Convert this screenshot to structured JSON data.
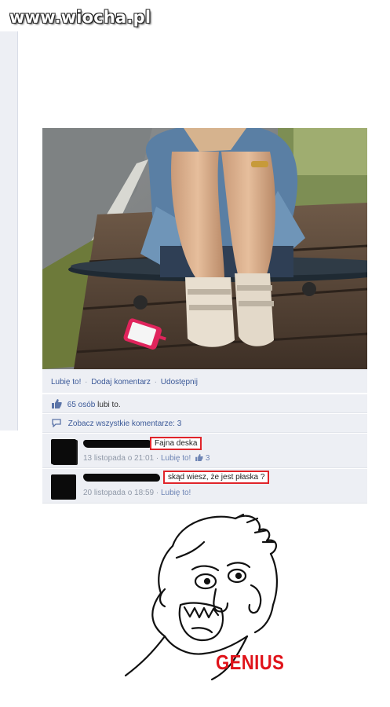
{
  "watermark": "www.wiocha.pl",
  "photo": {
    "description_icon": "photo-image"
  },
  "actions": {
    "like": "Lubię to!",
    "comment": "Dodaj komentarz",
    "share": "Udostępnij",
    "separator": "·"
  },
  "likes": {
    "count": "65 osób",
    "suffix": "lubi to."
  },
  "view_comments": "Zobacz wszystkie komentarze: 3",
  "comments": [
    {
      "text": "Fajna deska",
      "timestamp": "13 listopada o 21:01",
      "like": "Lubię to!",
      "likes_count": "3"
    },
    {
      "text": "skąd wiesz, że jest płaska ?",
      "timestamp": "20 listopada o 18:59",
      "like": "Lubię to!"
    }
  ],
  "meme": {
    "label": "GENIUS"
  },
  "colors": {
    "facebook_link": "#3b5998",
    "panel_bg": "#edeff4",
    "highlight": "#e0242a",
    "genius_red": "#e0131a"
  }
}
